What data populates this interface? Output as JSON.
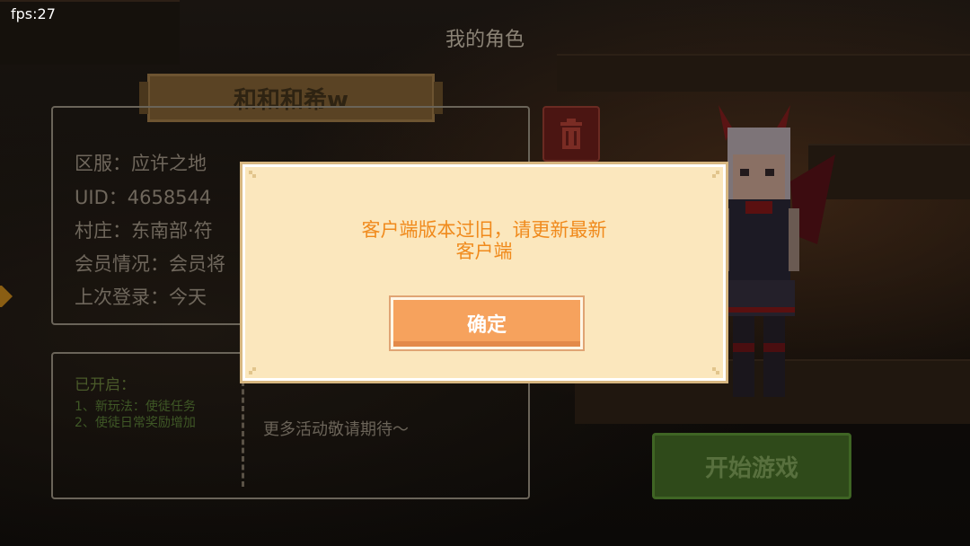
{
  "fps": "fps:27",
  "screen_title": "我的角色",
  "character": {
    "name": "和和和希w",
    "info": [
      "区服：应许之地",
      "UID：4658544",
      "村庄：东南部·符",
      "会员情况：会员将",
      "上次登录：今天"
    ]
  },
  "activities": {
    "title": "已开启：",
    "items": [
      "1、新玩法：使徒任务",
      "2、使徒日常奖励增加"
    ],
    "more": "更多活动敬请期待～"
  },
  "start_button": "开始游戏",
  "dialog": {
    "line1": "客户端版本过旧，请更新最新",
    "line2": "客户端",
    "confirm": "确定"
  },
  "colors": {
    "dialog_bg": "#fbe7bd",
    "dialog_text": "#f08a1c",
    "confirm_button": "#f6a25d",
    "start_button": "#2f4a1a",
    "delete_button": "#4b1512"
  }
}
